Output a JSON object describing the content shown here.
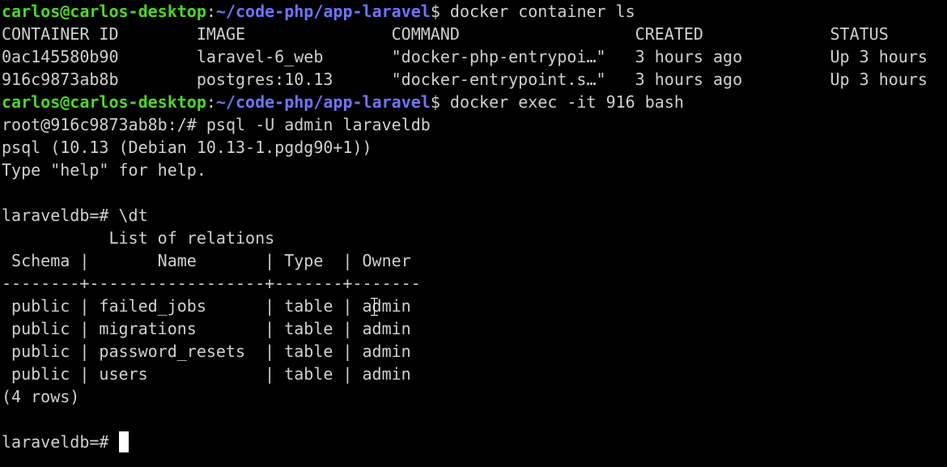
{
  "colors": {
    "background": "#000000",
    "text": "#d0d0d0",
    "prompt_user": "#4fd626",
    "prompt_path": "#6f74ff",
    "cursor": "#ffffff"
  },
  "prompt": {
    "user_host": "carlos@carlos-desktop",
    "separator": ":",
    "path": "~/code-php/app-laravel",
    "symbol": "$ "
  },
  "commands": {
    "docker_ls": "docker container ls",
    "docker_exec": "docker exec -it 916 bash"
  },
  "docker_table": {
    "header": "CONTAINER ID        IMAGE               COMMAND                  CREATED             STATUS",
    "rows": [
      "0ac145580b90        laravel-6_web       \"docker-php-entrypoi…\"   3 hours ago         Up 3 hours",
      "916c9873ab8b        postgres:10.13      \"docker-entrypoint.s…\"   3 hours ago         Up 3 hours"
    ]
  },
  "container_shell": {
    "command_line": "root@916c9873ab8b:/# psql -U admin laraveldb"
  },
  "psql": {
    "version": "psql (10.13 (Debian 10.13-1.pgdg90+1))",
    "help_hint": "Type \"help\" for help.",
    "blank": "",
    "dt_command": "laraveldb=# \\dt",
    "relations_title": "           List of relations",
    "relations_header": " Schema |       Name       | Type  | Owner",
    "relations_divider": "--------+------------------+-------+-------",
    "relations_rows": [
      " public | failed_jobs      | table | admin",
      " public | migrations       | table | admin",
      " public | password_resets  | table | admin",
      " public | users            | table | admin"
    ],
    "row_count": "(4 rows)",
    "final_prompt": "laraveldb=# "
  },
  "icons": {
    "cursor": "text-cursor-block",
    "mouse": "ibeam-mouse-cursor"
  }
}
